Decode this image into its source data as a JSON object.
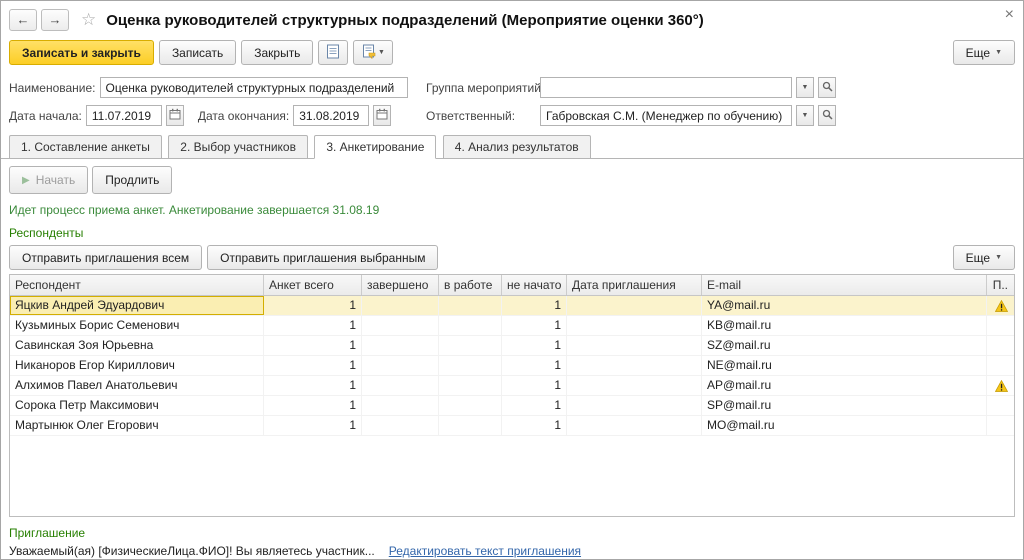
{
  "window": {
    "title": "Оценка руководителей структурных подразделений (Мероприятие оценки 360°)"
  },
  "icons": {
    "back": "←",
    "forward": "→",
    "star": "☆",
    "close": "×",
    "caret": "▼",
    "play": "▶"
  },
  "colors": {
    "primary_button": "#fcce25",
    "group_label_green": "#267f00",
    "status_green": "#3a8a3a",
    "link_blue": "#3366aa",
    "selection_yellow": "#fbf3cc",
    "warning_yellow": "#f5c518"
  },
  "toolbar": {
    "save_close": "Записать и закрыть",
    "save": "Записать",
    "close": "Закрыть",
    "more": "Еще"
  },
  "fields": {
    "name_label": "Наименование:",
    "name_value": "Оценка руководителей структурных подразделений",
    "group_label": "Группа мероприятий:",
    "group_value": "",
    "date_start_label": "Дата начала:",
    "date_start_value": "11.07.2019",
    "date_end_label": "Дата окончания:",
    "date_end_value": "31.08.2019",
    "responsible_label": "Ответственный:",
    "responsible_value": "Габровская С.М. (Менеджер по обучению)"
  },
  "tabs": [
    {
      "label": "1. Составление анкеты"
    },
    {
      "label": "2. Выбор участников"
    },
    {
      "label": "3. Анкетирование"
    },
    {
      "label": "4. Анализ результатов"
    }
  ],
  "survey": {
    "start_button": "Начать",
    "extend_button": "Продлить",
    "status_text": "Идет процесс приема анкет. Анкетирование завершается 31.08.19",
    "respondents_label": "Респонденты",
    "send_all_button": "Отправить приглашения всем",
    "send_selected_button": "Отправить приглашения выбранным",
    "more_button": "Еще"
  },
  "table": {
    "columns": [
      "Респондент",
      "Анкет всего",
      "завершено",
      "в работе",
      "не начато",
      "Дата приглашения",
      "E-mail",
      "П.."
    ],
    "rows": [
      {
        "name": "Яцкив Андрей Эдуардович",
        "total": "1",
        "done": "",
        "in_progress": "",
        "not_started": "1",
        "invite_date": "",
        "email": "YA@mail.ru",
        "warning": true,
        "selected": true
      },
      {
        "name": "Кузьминых Борис Семенович",
        "total": "1",
        "done": "",
        "in_progress": "",
        "not_started": "1",
        "invite_date": "",
        "email": "KB@mail.ru",
        "warning": false,
        "selected": false
      },
      {
        "name": "Савинская Зоя Юрьевна",
        "total": "1",
        "done": "",
        "in_progress": "",
        "not_started": "1",
        "invite_date": "",
        "email": "SZ@mail.ru",
        "warning": false,
        "selected": false
      },
      {
        "name": "Никаноров Егор Кириллович",
        "total": "1",
        "done": "",
        "in_progress": "",
        "not_started": "1",
        "invite_date": "",
        "email": "NE@mail.ru",
        "warning": false,
        "selected": false
      },
      {
        "name": "Алхимов Павел Анатольевич",
        "total": "1",
        "done": "",
        "in_progress": "",
        "not_started": "1",
        "invite_date": "",
        "email": "AP@mail.ru",
        "warning": true,
        "selected": false
      },
      {
        "name": "Сорока Петр Максимович",
        "total": "1",
        "done": "",
        "in_progress": "",
        "not_started": "1",
        "invite_date": "",
        "email": "SP@mail.ru",
        "warning": false,
        "selected": false
      },
      {
        "name": "Мартынюк Олег Егорович",
        "total": "1",
        "done": "",
        "in_progress": "",
        "not_started": "1",
        "invite_date": "",
        "email": "MO@mail.ru",
        "warning": false,
        "selected": false
      }
    ]
  },
  "invitation": {
    "label": "Приглашение",
    "text": "Уважаемый(ая) [ФизическиеЛица.ФИО]! Вы являетесь участник...",
    "edit_link": "Редактировать текст приглашения"
  }
}
